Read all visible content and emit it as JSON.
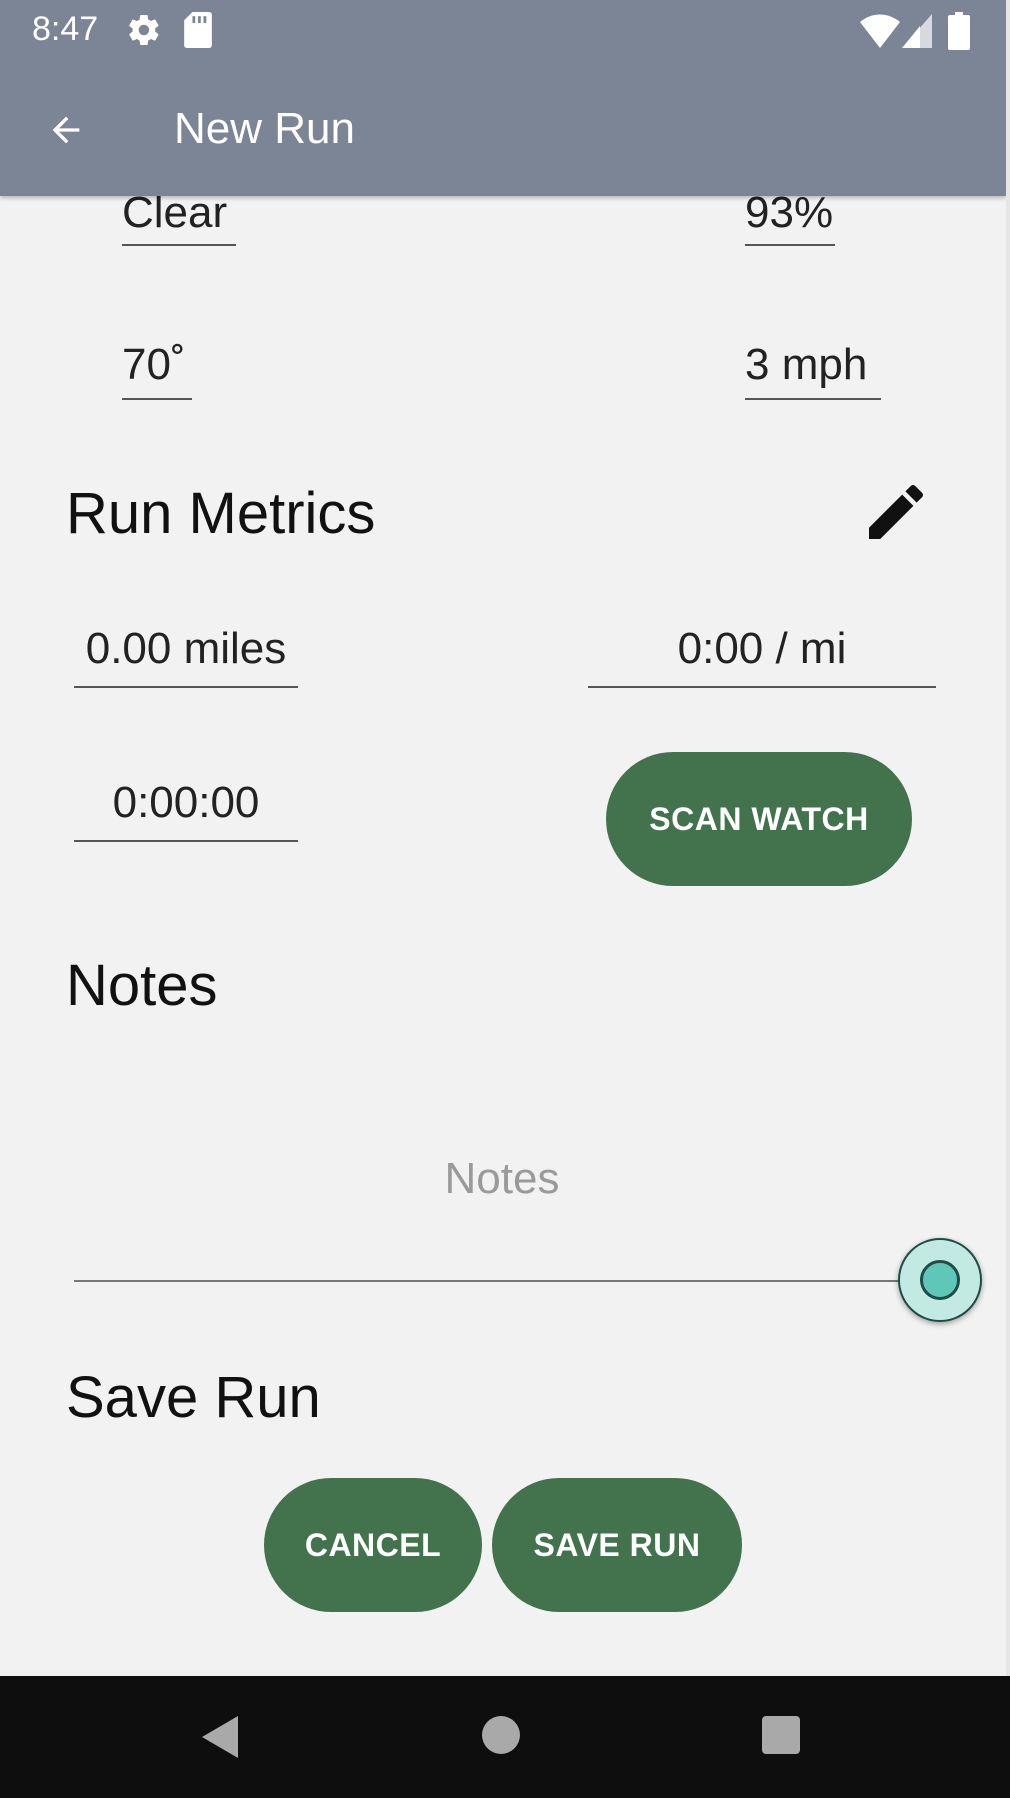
{
  "status_bar": {
    "time": "8:47",
    "icons": [
      "gear-icon",
      "sd-card-icon",
      "wifi-icon",
      "signal-icon",
      "battery-icon"
    ]
  },
  "app_bar": {
    "title": "New Run",
    "back_icon": "arrow-left-icon",
    "color": "#7c8595"
  },
  "weather": {
    "condition": "Clear",
    "humidity": "93%",
    "temperature": "70˚",
    "wind": "3 mph"
  },
  "run_metrics": {
    "title": "Run Metrics",
    "edit_icon": "pencil-icon",
    "distance": "0.00 miles",
    "pace": "0:00 / mi",
    "duration": "0:00:00",
    "scan_button": "SCAN WATCH"
  },
  "notes": {
    "title": "Notes",
    "placeholder": "Notes"
  },
  "save": {
    "title": "Save Run",
    "cancel_button": "CANCEL",
    "save_button": "SAVE RUN"
  },
  "colors": {
    "accent": "#42734d",
    "background": "#f2f2f2"
  },
  "nav_bar": {
    "icons": [
      "nav-back-icon",
      "nav-home-icon",
      "nav-recents-icon"
    ]
  }
}
